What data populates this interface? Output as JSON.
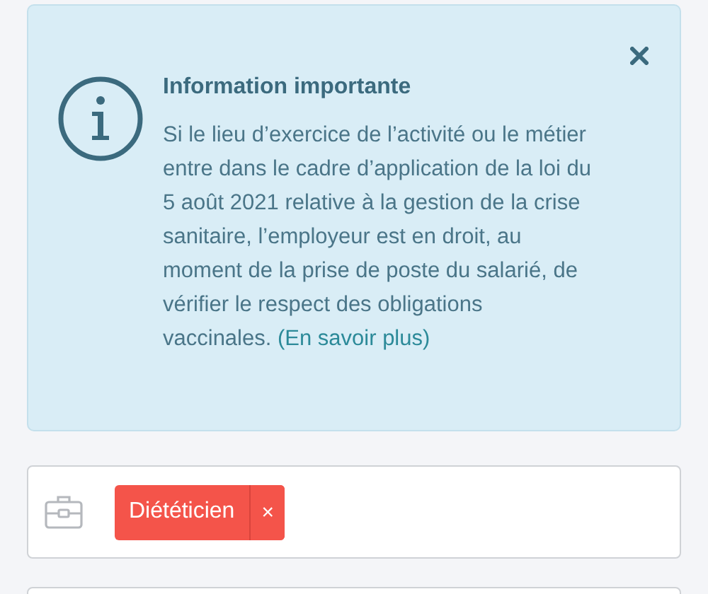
{
  "alert": {
    "title": "Information importante",
    "text": "Si le lieu d’exercice de l’activité ou le métier entre dans le cadre d’application de la loi du 5 août 2021 relative à la gestion de la crise sanitaire, l’employeur est en droit, au moment de la prise de poste du salarié, de vérifier le respect des obligations vaccinales.",
    "link": "(En savoir plus)"
  },
  "job_field": {
    "tags": [
      {
        "label": "Diététicien",
        "remove": "×"
      }
    ]
  }
}
